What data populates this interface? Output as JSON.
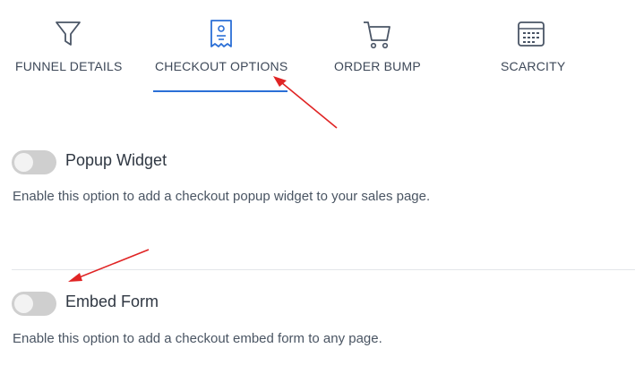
{
  "tabs": [
    {
      "label": "FUNNEL DETAILS",
      "icon": "funnel-icon",
      "active": false
    },
    {
      "label": "CHECKOUT OPTIONS",
      "icon": "receipt-icon",
      "active": true
    },
    {
      "label": "ORDER BUMP",
      "icon": "cart-icon",
      "active": false
    },
    {
      "label": "SCARCITY",
      "icon": "calendar-icon",
      "active": false
    }
  ],
  "settings": [
    {
      "title": "Popup Widget",
      "description": "Enable this option to add a checkout popup widget to your sales page.",
      "enabled": false
    },
    {
      "title": "Embed Form",
      "description": "Enable this option to add a checkout embed form to any page.",
      "enabled": false
    }
  ],
  "colors": {
    "active_tab_icon": "#2b6fd6",
    "tab_icon": "#4a5566",
    "underline": "#2b6fd6",
    "toggle_off": "#cfcfcf",
    "annotation_arrow": "#e02424"
  }
}
